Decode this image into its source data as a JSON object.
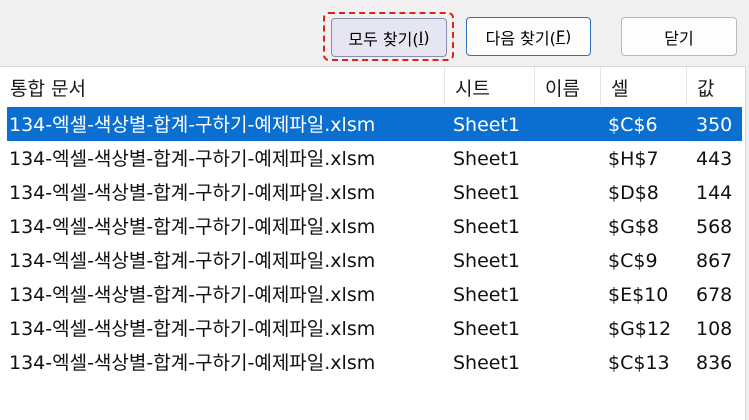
{
  "toolbar": {
    "find_all_label": "모두 찾기(",
    "find_all_key": "I",
    "find_next_label": "다음 찾기(",
    "find_next_key": "F",
    "close_label": "닫기",
    "paren_close": ")"
  },
  "table": {
    "columns": [
      "통합 문서",
      "시트",
      "이름",
      "셀",
      "값"
    ],
    "rows": [
      {
        "doc": "134-엑셀-색상별-합계-구하기-예제파일.xlsm",
        "sheet": "Sheet1",
        "name": "",
        "cell": "$C$6",
        "value": "350",
        "selected": true
      },
      {
        "doc": "134-엑셀-색상별-합계-구하기-예제파일.xlsm",
        "sheet": "Sheet1",
        "name": "",
        "cell": "$H$7",
        "value": "443"
      },
      {
        "doc": "134-엑셀-색상별-합계-구하기-예제파일.xlsm",
        "sheet": "Sheet1",
        "name": "",
        "cell": "$D$8",
        "value": "144"
      },
      {
        "doc": "134-엑셀-색상별-합계-구하기-예제파일.xlsm",
        "sheet": "Sheet1",
        "name": "",
        "cell": "$G$8",
        "value": "568"
      },
      {
        "doc": "134-엑셀-색상별-합계-구하기-예제파일.xlsm",
        "sheet": "Sheet1",
        "name": "",
        "cell": "$C$9",
        "value": "867"
      },
      {
        "doc": "134-엑셀-색상별-합계-구하기-예제파일.xlsm",
        "sheet": "Sheet1",
        "name": "",
        "cell": "$E$10",
        "value": "678"
      },
      {
        "doc": "134-엑셀-색상별-합계-구하기-예제파일.xlsm",
        "sheet": "Sheet1",
        "name": "",
        "cell": "$G$12",
        "value": "108"
      },
      {
        "doc": "134-엑셀-색상별-합계-구하기-예제파일.xlsm",
        "sheet": "Sheet1",
        "name": "",
        "cell": "$C$13",
        "value": "836"
      }
    ]
  },
  "colors": {
    "selection": "#0a6fd1",
    "highlight_outline": "#e0201b"
  }
}
